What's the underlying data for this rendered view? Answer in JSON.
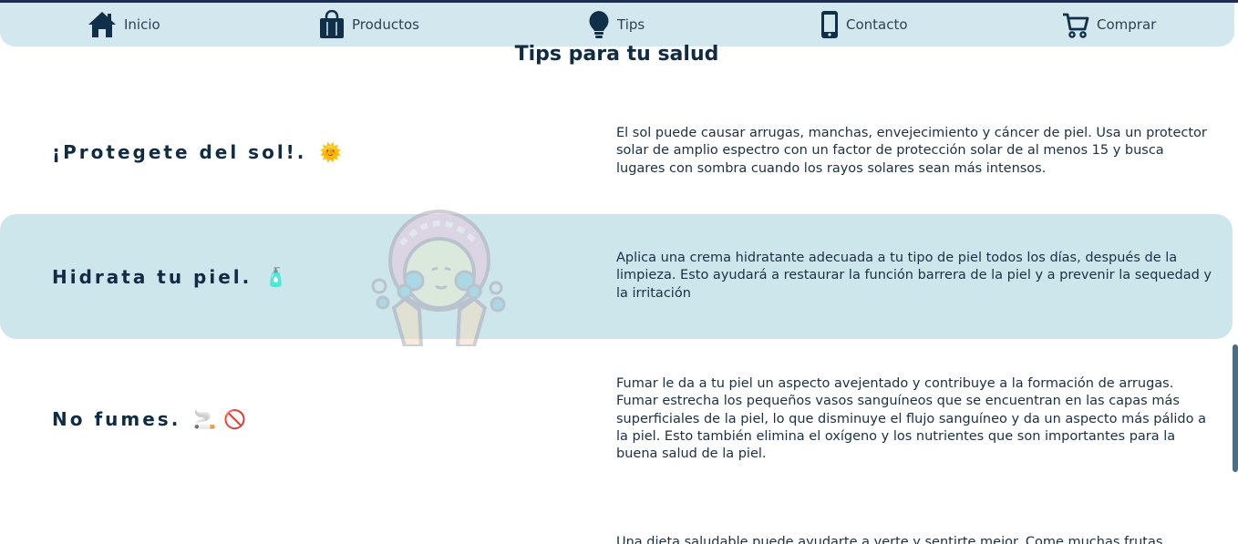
{
  "nav": {
    "items": [
      {
        "label": "Inicio",
        "icon": "home-icon"
      },
      {
        "label": "Productos",
        "icon": "shop-bag-icon"
      },
      {
        "label": "Tips",
        "icon": "lightbulb-icon"
      },
      {
        "label": "Contacto",
        "icon": "phone-icon"
      },
      {
        "label": "Comprar",
        "icon": "cart-icon"
      }
    ]
  },
  "page": {
    "title": "Tips para tu salud"
  },
  "tips": [
    {
      "heading": "¡Protegete del sol!.",
      "emoji": "🌞",
      "text": "El sol puede causar arrugas, manchas, envejecimiento y cáncer de piel. Usa un protector solar de amplio espectro con un factor de protección solar de al menos 15 y busca lugares con sombra cuando los rayos solares sean más intensos."
    },
    {
      "heading": "Hidrata tu piel.",
      "emoji": "🧴",
      "text": "Aplica una crema hidratante adecuada a tu tipo de piel todos los días, después de la limpieza. Esto ayudará a restaurar la función barrera de la piel y a prevenir la sequedad y la irritación"
    },
    {
      "heading": "No fumes.",
      "emoji": "🚬",
      "emoji2": "🚫",
      "text": "Fumar le da a tu piel un aspecto avejentado y contribuye a la formación de arrugas. Fumar estrecha los pequeños vasos sanguíneos que se encuentran en las capas más superficiales de la piel, lo que disminuye el flujo sanguíneo y da un aspecto más pálido a la piel. Esto también elimina el oxígeno y los nutrientes que son importantes para la buena salud de la piel."
    },
    {
      "text": "Una dieta saludable puede ayudarte a verte y sentirte mejor. Come muchas frutas"
    }
  ],
  "colors": {
    "navbar": "#d3e8ee",
    "highlight": "#cde6ec",
    "text": "#0f2c44"
  }
}
